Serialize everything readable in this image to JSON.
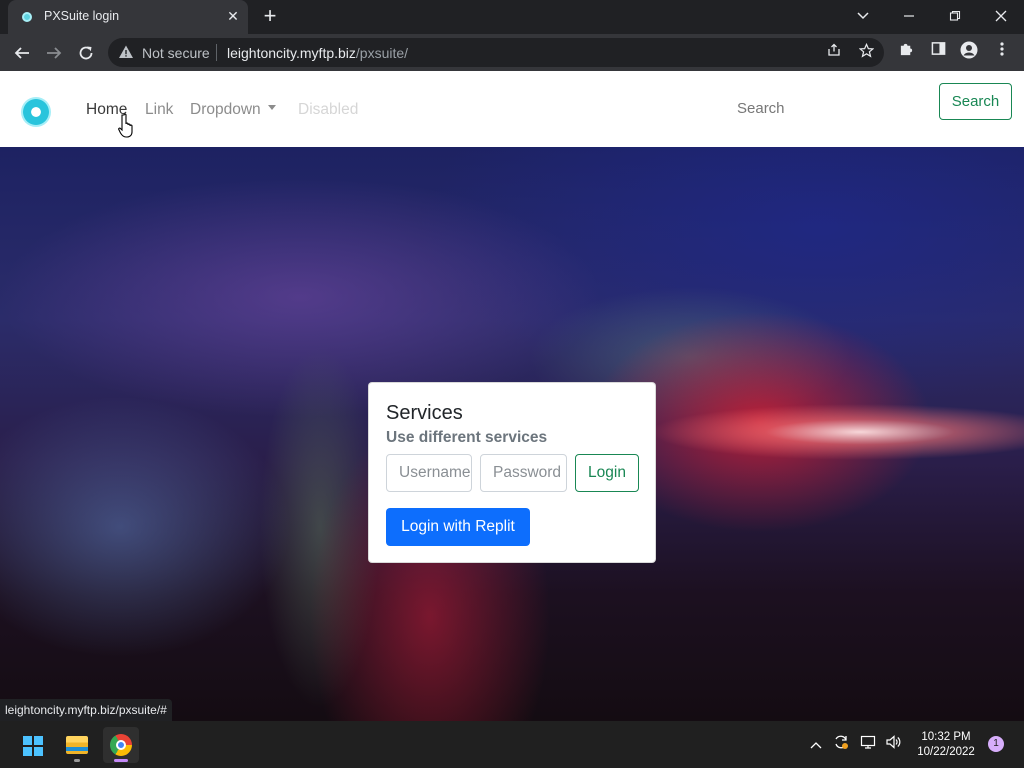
{
  "browser": {
    "tab_title": "PXSuite login",
    "tab_close": "✕",
    "new_tab": "+",
    "security_label": "Not secure",
    "url_host": "leightoncity.myftp.biz",
    "url_path": "/pxsuite/",
    "status_url": "leightoncity.myftp.biz/pxsuite/#"
  },
  "navbar": {
    "links": [
      {
        "label": "Home",
        "state": "active"
      },
      {
        "label": "Link",
        "state": "normal"
      },
      {
        "label": "Dropdown",
        "state": "dropdown"
      },
      {
        "label": "Disabled",
        "state": "disabled"
      }
    ],
    "search_placeholder": "Search",
    "search_button": "Search"
  },
  "card": {
    "title": "Services",
    "subtitle": "Use different services",
    "username_placeholder": "Username",
    "password_placeholder": "Password",
    "login_button": "Login",
    "replit_button": "Login with Replit"
  },
  "taskbar": {
    "time": "10:32 PM",
    "date": "10/22/2022",
    "notification_count": "1"
  },
  "colors": {
    "success": "#198754",
    "primary": "#0d6efd",
    "taskbar_accent": "#c58af9"
  }
}
